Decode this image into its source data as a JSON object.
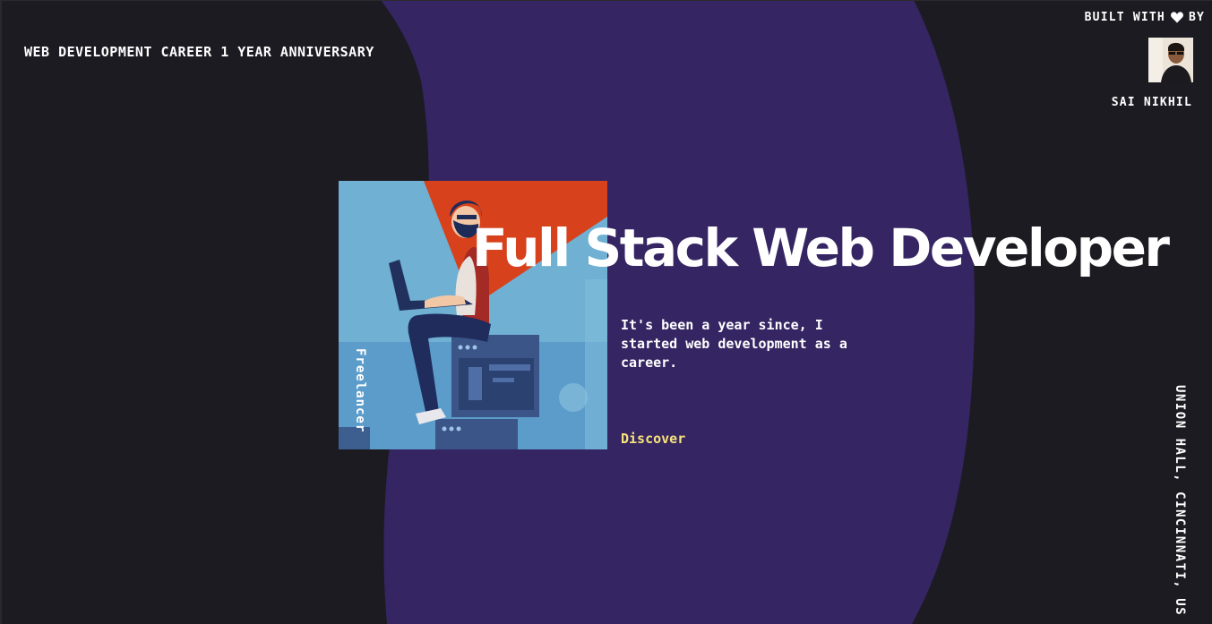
{
  "header": {
    "title": "WEB DEVELOPMENT CAREER 1 YEAR ANNIVERSARY"
  },
  "credit": {
    "prefix": "BUILT WITH",
    "icon": "heart-icon",
    "suffix": "BY",
    "author_name": "SAI NIKHIL"
  },
  "hero": {
    "headline": "Full Stack Web Developer",
    "intro": "It's been a year since, I started web development as a career.",
    "cta_label": "Discover",
    "illustration_label": "Freelancer"
  },
  "location": "UNION HALL, CINCINNATI, US",
  "colors": {
    "background": "#1c1b21",
    "blob": "#352563",
    "accent_link": "#f7e27a",
    "illustration_sky": "#6fb0d3",
    "illustration_orange": "#d7411b"
  }
}
